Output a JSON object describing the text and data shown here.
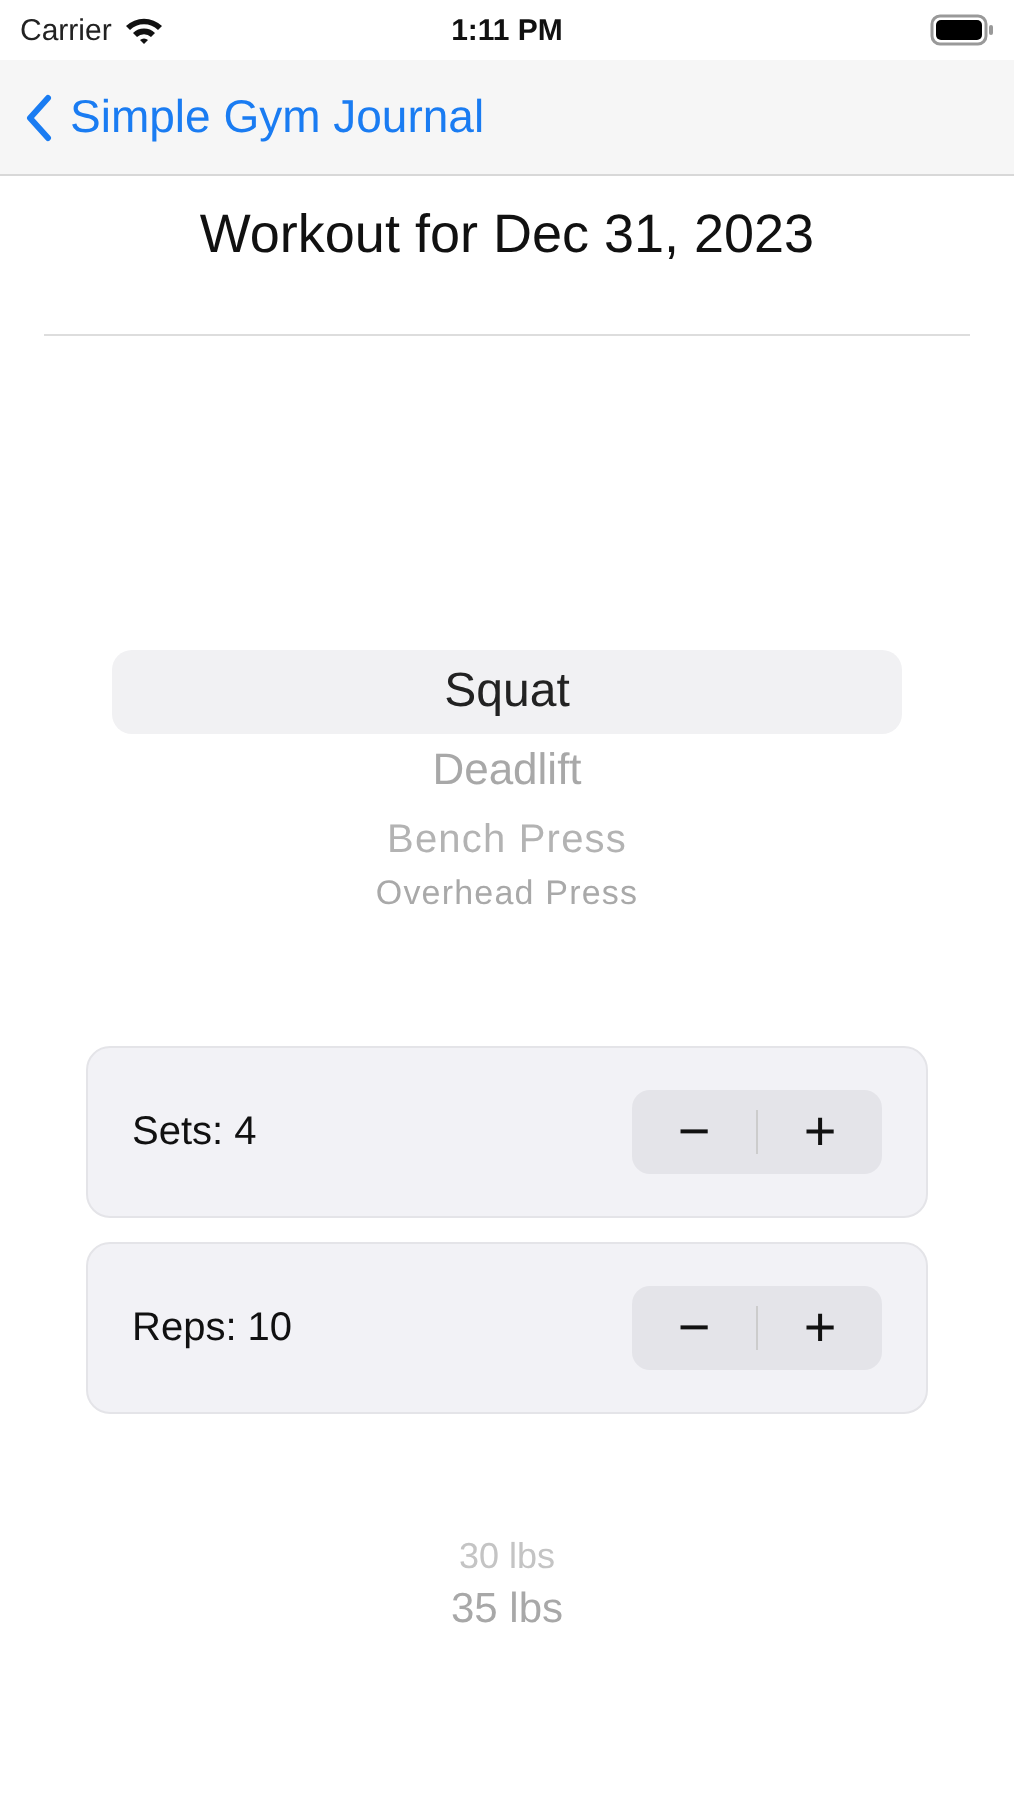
{
  "status_bar": {
    "carrier": "Carrier",
    "time": "1:11 PM"
  },
  "nav_bar": {
    "back_label": "Simple Gym Journal"
  },
  "title": "Workout for Dec 31, 2023",
  "exercise_picker": [
    {
      "label": "Squat",
      "selected": true
    },
    {
      "label": "Deadlift",
      "selected": false
    },
    {
      "label": "Bench Press",
      "selected": false
    },
    {
      "label": "Overhead Press",
      "selected": false
    }
  ],
  "steppers": [
    {
      "label": "Sets: 4",
      "minus": "−",
      "plus": "+"
    },
    {
      "label": "Reps: 10",
      "minus": "−",
      "plus": "+"
    }
  ],
  "weight_picker": [
    {
      "label": "30 lbs",
      "selected": false
    },
    {
      "label": "35 lbs",
      "selected": false
    }
  ]
}
